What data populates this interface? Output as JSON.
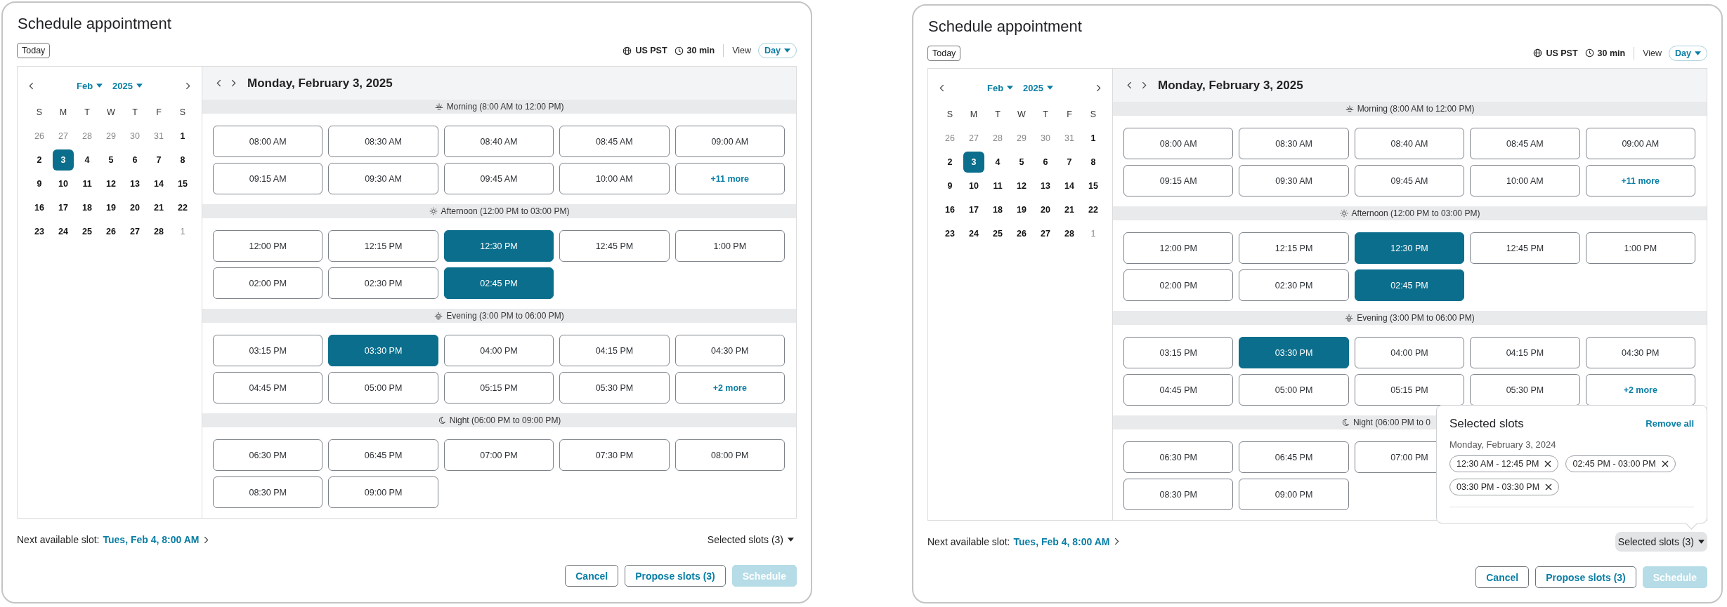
{
  "dialogs": [
    {
      "title": "Schedule appointment",
      "today_button": "Today",
      "timezone": "US PST",
      "duration": "30 min",
      "view_label": "View",
      "view_value": "Day",
      "calendar": {
        "month": "Feb",
        "year": "2025",
        "weekdays": [
          "S",
          "M",
          "T",
          "W",
          "T",
          "F",
          "S"
        ],
        "days": [
          {
            "label": "26",
            "outside": true,
            "selected": false
          },
          {
            "label": "27",
            "outside": true,
            "selected": false
          },
          {
            "label": "28",
            "outside": true,
            "selected": false
          },
          {
            "label": "29",
            "outside": true,
            "selected": false
          },
          {
            "label": "30",
            "outside": true,
            "selected": false
          },
          {
            "label": "31",
            "outside": true,
            "selected": false
          },
          {
            "label": "1",
            "outside": false,
            "selected": false
          },
          {
            "label": "2",
            "outside": false,
            "selected": false
          },
          {
            "label": "3",
            "outside": false,
            "selected": true
          },
          {
            "label": "4",
            "outside": false,
            "selected": false
          },
          {
            "label": "5",
            "outside": false,
            "selected": false
          },
          {
            "label": "6",
            "outside": false,
            "selected": false
          },
          {
            "label": "7",
            "outside": false,
            "selected": false
          },
          {
            "label": "8",
            "outside": false,
            "selected": false
          },
          {
            "label": "9",
            "outside": false,
            "selected": false
          },
          {
            "label": "10",
            "outside": false,
            "selected": false
          },
          {
            "label": "11",
            "outside": false,
            "selected": false
          },
          {
            "label": "12",
            "outside": false,
            "selected": false
          },
          {
            "label": "13",
            "outside": false,
            "selected": false
          },
          {
            "label": "14",
            "outside": false,
            "selected": false
          },
          {
            "label": "15",
            "outside": false,
            "selected": false
          },
          {
            "label": "16",
            "outside": false,
            "selected": false
          },
          {
            "label": "17",
            "outside": false,
            "selected": false
          },
          {
            "label": "18",
            "outside": false,
            "selected": false
          },
          {
            "label": "19",
            "outside": false,
            "selected": false
          },
          {
            "label": "20",
            "outside": false,
            "selected": false
          },
          {
            "label": "21",
            "outside": false,
            "selected": false
          },
          {
            "label": "22",
            "outside": false,
            "selected": false
          },
          {
            "label": "23",
            "outside": false,
            "selected": false
          },
          {
            "label": "24",
            "outside": false,
            "selected": false
          },
          {
            "label": "25",
            "outside": false,
            "selected": false
          },
          {
            "label": "26",
            "outside": false,
            "selected": false
          },
          {
            "label": "27",
            "outside": false,
            "selected": false
          },
          {
            "label": "28",
            "outside": false,
            "selected": false
          },
          {
            "label": "1",
            "outside": true,
            "selected": false
          }
        ]
      },
      "day_title": "Monday, February 3, 2025",
      "sections": [
        {
          "kind": "morning",
          "label": "Morning (8:00 AM to 12:00 PM)",
          "rows": [
            [
              {
                "label": "08:00 AM",
                "kind": "time",
                "selected": false
              },
              {
                "label": "08:30 AM",
                "kind": "time",
                "selected": false
              },
              {
                "label": "08:40 AM",
                "kind": "time",
                "selected": false
              },
              {
                "label": "08:45 AM",
                "kind": "time",
                "selected": false
              },
              {
                "label": "09:00 AM",
                "kind": "time",
                "selected": false
              }
            ],
            [
              {
                "label": "09:15 AM",
                "kind": "time",
                "selected": false
              },
              {
                "label": "09:30 AM",
                "kind": "time",
                "selected": false
              },
              {
                "label": "09:45 AM",
                "kind": "time",
                "selected": false
              },
              {
                "label": "10:00 AM",
                "kind": "time",
                "selected": false
              },
              {
                "label": "+11 more",
                "kind": "more",
                "selected": false
              }
            ]
          ]
        },
        {
          "kind": "afternoon",
          "label": "Afternoon (12:00 PM to 03:00 PM)",
          "rows": [
            [
              {
                "label": "12:00 PM",
                "kind": "time",
                "selected": false
              },
              {
                "label": "12:15 PM",
                "kind": "time",
                "selected": false
              },
              {
                "label": "12:30 PM",
                "kind": "time",
                "selected": true
              },
              {
                "label": "12:45 PM",
                "kind": "time",
                "selected": false
              },
              {
                "label": "1:00 PM",
                "kind": "time",
                "selected": false
              }
            ],
            [
              {
                "label": "02:00 PM",
                "kind": "time",
                "selected": false
              },
              {
                "label": "02:30 PM",
                "kind": "time",
                "selected": false
              },
              {
                "label": "02:45 PM",
                "kind": "time",
                "selected": true
              }
            ]
          ]
        },
        {
          "kind": "evening",
          "label": "Evening (3:00 PM to 06:00 PM)",
          "rows": [
            [
              {
                "label": "03:15 PM",
                "kind": "time",
                "selected": false
              },
              {
                "label": "03:30 PM",
                "kind": "time",
                "selected": true
              },
              {
                "label": "04:00 PM",
                "kind": "time",
                "selected": false
              },
              {
                "label": "04:15 PM",
                "kind": "time",
                "selected": false
              },
              {
                "label": "04:30 PM",
                "kind": "time",
                "selected": false
              }
            ],
            [
              {
                "label": "04:45 PM",
                "kind": "time",
                "selected": false
              },
              {
                "label": "05:00 PM",
                "kind": "time",
                "selected": false
              },
              {
                "label": "05:15 PM",
                "kind": "time",
                "selected": false
              },
              {
                "label": "05:30 PM",
                "kind": "time",
                "selected": false
              },
              {
                "label": "+2 more",
                "kind": "more",
                "selected": false
              }
            ]
          ]
        },
        {
          "kind": "night",
          "label": "Night (06:00 PM to 09:00 PM)",
          "rows": [
            [
              {
                "label": "06:30 PM",
                "kind": "time",
                "selected": false
              },
              {
                "label": "06:45 PM",
                "kind": "time",
                "selected": false
              },
              {
                "label": "07:00 PM",
                "kind": "time",
                "selected": false
              },
              {
                "label": "07:30 PM",
                "kind": "time",
                "selected": false
              },
              {
                "label": "08:00 PM",
                "kind": "time",
                "selected": false
              }
            ],
            [
              {
                "label": "08:30 PM",
                "kind": "time",
                "selected": false
              },
              {
                "label": "09:00 PM",
                "kind": "time",
                "selected": false
              }
            ]
          ]
        }
      ],
      "next_slot_label": "Next available slot:",
      "next_slot_link": "Tues, Feb 4, 8:00 AM",
      "selected_toggle": {
        "label": "Selected slots (3)",
        "expanded": false
      },
      "buttons": [
        {
          "label": "Cancel",
          "kind": "secondary",
          "disabled": false
        },
        {
          "label": "Propose slots (3)",
          "kind": "secondary",
          "disabled": false
        },
        {
          "label": "Schedule",
          "kind": "primary",
          "disabled": true
        }
      ]
    },
    {
      "title": "Schedule appointment",
      "today_button": "Today",
      "timezone": "US PST",
      "duration": "30 min",
      "view_label": "View",
      "view_value": "Day",
      "calendar": {
        "month": "Feb",
        "year": "2025",
        "weekdays": [
          "S",
          "M",
          "T",
          "W",
          "T",
          "F",
          "S"
        ],
        "days": [
          {
            "label": "26",
            "outside": true,
            "selected": false
          },
          {
            "label": "27",
            "outside": true,
            "selected": false
          },
          {
            "label": "28",
            "outside": true,
            "selected": false
          },
          {
            "label": "29",
            "outside": true,
            "selected": false
          },
          {
            "label": "30",
            "outside": true,
            "selected": false
          },
          {
            "label": "31",
            "outside": true,
            "selected": false
          },
          {
            "label": "1",
            "outside": false,
            "selected": false
          },
          {
            "label": "2",
            "outside": false,
            "selected": false
          },
          {
            "label": "3",
            "outside": false,
            "selected": true
          },
          {
            "label": "4",
            "outside": false,
            "selected": false
          },
          {
            "label": "5",
            "outside": false,
            "selected": false
          },
          {
            "label": "6",
            "outside": false,
            "selected": false
          },
          {
            "label": "7",
            "outside": false,
            "selected": false
          },
          {
            "label": "8",
            "outside": false,
            "selected": false
          },
          {
            "label": "9",
            "outside": false,
            "selected": false
          },
          {
            "label": "10",
            "outside": false,
            "selected": false
          },
          {
            "label": "11",
            "outside": false,
            "selected": false
          },
          {
            "label": "12",
            "outside": false,
            "selected": false
          },
          {
            "label": "13",
            "outside": false,
            "selected": false
          },
          {
            "label": "14",
            "outside": false,
            "selected": false
          },
          {
            "label": "15",
            "outside": false,
            "selected": false
          },
          {
            "label": "16",
            "outside": false,
            "selected": false
          },
          {
            "label": "17",
            "outside": false,
            "selected": false
          },
          {
            "label": "18",
            "outside": false,
            "selected": false
          },
          {
            "label": "19",
            "outside": false,
            "selected": false
          },
          {
            "label": "20",
            "outside": false,
            "selected": false
          },
          {
            "label": "21",
            "outside": false,
            "selected": false
          },
          {
            "label": "22",
            "outside": false,
            "selected": false
          },
          {
            "label": "23",
            "outside": false,
            "selected": false
          },
          {
            "label": "24",
            "outside": false,
            "selected": false
          },
          {
            "label": "25",
            "outside": false,
            "selected": false
          },
          {
            "label": "26",
            "outside": false,
            "selected": false
          },
          {
            "label": "27",
            "outside": false,
            "selected": false
          },
          {
            "label": "28",
            "outside": false,
            "selected": false
          },
          {
            "label": "1",
            "outside": true,
            "selected": false
          }
        ]
      },
      "day_title": "Monday, February 3, 2025",
      "sections": [
        {
          "kind": "morning",
          "label": "Morning (8:00 AM to 12:00 PM)",
          "rows": [
            [
              {
                "label": "08:00 AM",
                "kind": "time",
                "selected": false
              },
              {
                "label": "08:30 AM",
                "kind": "time",
                "selected": false
              },
              {
                "label": "08:40 AM",
                "kind": "time",
                "selected": false
              },
              {
                "label": "08:45 AM",
                "kind": "time",
                "selected": false
              },
              {
                "label": "09:00 AM",
                "kind": "time",
                "selected": false
              }
            ],
            [
              {
                "label": "09:15 AM",
                "kind": "time",
                "selected": false
              },
              {
                "label": "09:30 AM",
                "kind": "time",
                "selected": false
              },
              {
                "label": "09:45 AM",
                "kind": "time",
                "selected": false
              },
              {
                "label": "10:00 AM",
                "kind": "time",
                "selected": false
              },
              {
                "label": "+11 more",
                "kind": "more",
                "selected": false
              }
            ]
          ]
        },
        {
          "kind": "afternoon",
          "label": "Afternoon (12:00 PM to 03:00 PM)",
          "rows": [
            [
              {
                "label": "12:00 PM",
                "kind": "time",
                "selected": false
              },
              {
                "label": "12:15 PM",
                "kind": "time",
                "selected": false
              },
              {
                "label": "12:30 PM",
                "kind": "time",
                "selected": true
              },
              {
                "label": "12:45 PM",
                "kind": "time",
                "selected": false
              },
              {
                "label": "1:00 PM",
                "kind": "time",
                "selected": false
              }
            ],
            [
              {
                "label": "02:00 PM",
                "kind": "time",
                "selected": false
              },
              {
                "label": "02:30 PM",
                "kind": "time",
                "selected": false
              },
              {
                "label": "02:45 PM",
                "kind": "time",
                "selected": true
              }
            ]
          ]
        },
        {
          "kind": "evening",
          "label": "Evening (3:00 PM to 06:00 PM)",
          "rows": [
            [
              {
                "label": "03:15 PM",
                "kind": "time",
                "selected": false
              },
              {
                "label": "03:30 PM",
                "kind": "time",
                "selected": true
              },
              {
                "label": "04:00 PM",
                "kind": "time",
                "selected": false
              },
              {
                "label": "04:15 PM",
                "kind": "time",
                "selected": false
              },
              {
                "label": "04:30 PM",
                "kind": "time",
                "selected": false
              }
            ],
            [
              {
                "label": "04:45 PM",
                "kind": "time",
                "selected": false
              },
              {
                "label": "05:00 PM",
                "kind": "time",
                "selected": false
              },
              {
                "label": "05:15 PM",
                "kind": "time",
                "selected": false
              },
              {
                "label": "05:30 PM",
                "kind": "time",
                "selected": false
              },
              {
                "label": "+2 more",
                "kind": "more",
                "selected": false
              }
            ]
          ]
        },
        {
          "kind": "night",
          "label": "Night (06:00 PM to 0",
          "rows": [
            [
              {
                "label": "06:30 PM",
                "kind": "time",
                "selected": false
              },
              {
                "label": "06:45 PM",
                "kind": "time",
                "selected": false
              },
              {
                "label": "07:00 PM",
                "kind": "time",
                "selected": false
              }
            ],
            [
              {
                "label": "08:30 PM",
                "kind": "time",
                "selected": false
              },
              {
                "label": "09:00 PM",
                "kind": "time",
                "selected": false
              }
            ]
          ]
        }
      ],
      "next_slot_label": "Next available slot:",
      "next_slot_link": "Tues, Feb 4, 8:00 AM",
      "selected_toggle": {
        "label": "Selected slots (3)",
        "expanded": true
      },
      "popover": {
        "title": "Selected slots",
        "remove_all": "Remove all",
        "date": "Monday, February 3, 2024",
        "chips": [
          "12:30 AM - 12:45 PM",
          "02:45 PM - 03:00 PM",
          "03:30 PM - 03:30 PM"
        ]
      },
      "buttons": [
        {
          "label": "Cancel",
          "kind": "secondary",
          "disabled": false
        },
        {
          "label": "Propose slots (3)",
          "kind": "secondary",
          "disabled": false
        },
        {
          "label": "Schedule",
          "kind": "primary",
          "disabled": true
        }
      ]
    }
  ]
}
